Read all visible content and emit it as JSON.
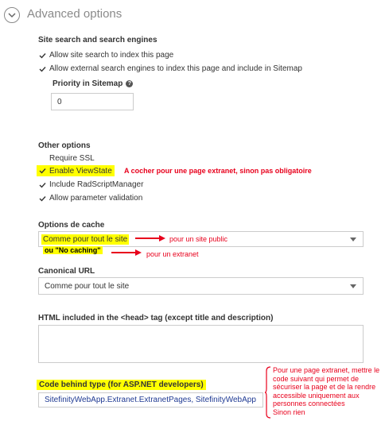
{
  "header": {
    "title": "Advanced options",
    "toggle_icon": "chevron-down-icon"
  },
  "site_search": {
    "heading": "Site search and search engines",
    "options": [
      {
        "label": "Allow site search to index this page",
        "checked": true
      },
      {
        "label": "Allow external search engines to index this page and include in Sitemap",
        "checked": true
      }
    ],
    "priority_label": "Priority in Sitemap",
    "priority_value": "0"
  },
  "other_options": {
    "heading": "Other options",
    "require_ssl": {
      "label": "Require SSL",
      "checked": false
    },
    "enable_viewstate": {
      "label": "Enable ViewState",
      "checked": true
    },
    "include_radscript": {
      "label": "Include RadScriptManager",
      "checked": true
    },
    "allow_param": {
      "label": "Allow parameter validation",
      "checked": true
    }
  },
  "cache": {
    "heading": "Options de cache",
    "selected": "Comme pour tout le site"
  },
  "canonical": {
    "heading": "Canonical URL",
    "selected": "Comme pour tout le site"
  },
  "html_head": {
    "heading": "HTML included in the <head> tag (except title and description)",
    "value": ""
  },
  "code_behind": {
    "heading": "Code behind type (for ASP.NET developers)",
    "value": "SitefinityWebApp.Extranet.ExtranetPages, SitefinityWebApp"
  },
  "annotations": {
    "viewstate_note": "A cocher pour une page extranet, sinon pas obligatoire",
    "cache_public": "pour un site public",
    "cache_ou": "ou \"No caching\"",
    "cache_extranet": "pour un extranet",
    "code_behind_note": [
      "Pour une page extranet, mettre le",
      "code suivant qui permet de",
      "sécuriser la page et de la rendre",
      "accessible uniquement aux",
      "personnes connectées",
      "Sinon rien"
    ]
  },
  "colors": {
    "highlight": "#ffff00",
    "annotation_red": "#e8001c"
  }
}
